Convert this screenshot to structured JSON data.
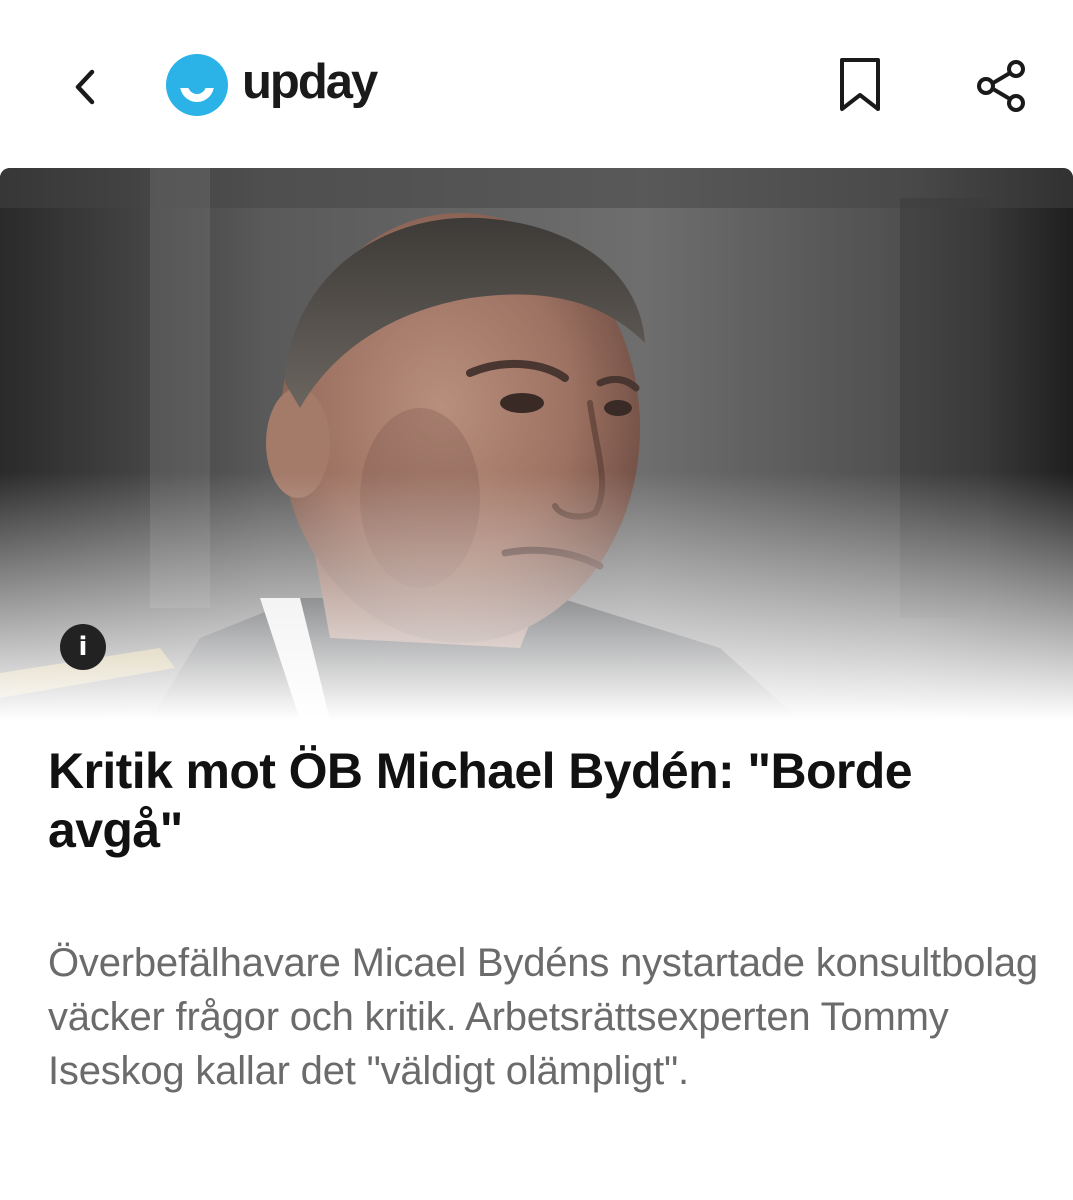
{
  "header": {
    "brand_name": "upday",
    "brand_color": "#2bb3e8",
    "back_icon": "chevron-left-icon",
    "bookmark_icon": "bookmark-icon",
    "share_icon": "share-icon"
  },
  "hero": {
    "info_label": "i"
  },
  "article": {
    "headline": "Kritik mot ÖB Michael Bydén: \"Borde avgå\"",
    "summary": "Överbefälhavare Micael Bydéns nystartade konsultbolag väcker frågor och kritik. Arbetsrättsexperten Tommy Iseskog kallar det \"väldigt olämpligt\"."
  }
}
